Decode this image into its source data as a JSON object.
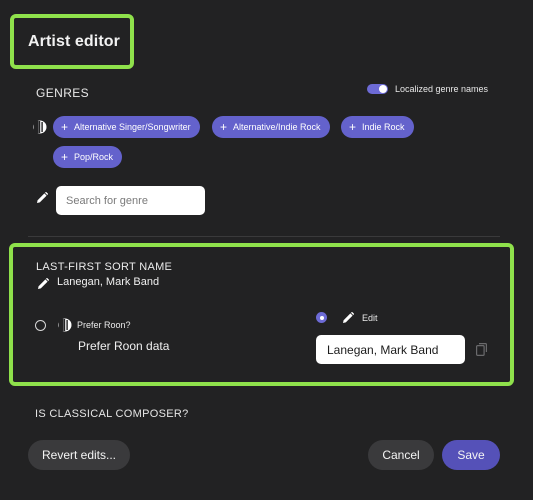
{
  "title": "Artist editor",
  "genres": {
    "heading": "GENRES",
    "toggle_label": "Localized genre names",
    "toggle_on": true,
    "chips": [
      {
        "label": "Alternative Singer/Songwriter"
      },
      {
        "label": "Alternative/Indie Rock"
      },
      {
        "label": "Indie Rock"
      },
      {
        "label": "Pop/Rock"
      }
    ],
    "search_placeholder": "Search for genre",
    "accent_color": "#6462cc"
  },
  "sort_name": {
    "heading": "LAST-FIRST SORT NAME",
    "current_value": "Lanegan, Mark Band",
    "prefer_roon_label": "Prefer Roon?",
    "prefer_roon_value": "Prefer Roon data",
    "edit_label": "Edit",
    "edit_value": "Lanegan, Mark Band",
    "selected_option": "edit"
  },
  "classical": {
    "heading": "IS CLASSICAL COMPOSER?"
  },
  "footer": {
    "revert_label": "Revert edits...",
    "cancel_label": "Cancel",
    "save_label": "Save"
  },
  "colors": {
    "highlight": "#8fe14b",
    "background": "#222223",
    "primary_button": "#5551b8"
  },
  "icons": [
    "roon-logo-icon",
    "plus-icon",
    "pencil-icon",
    "copy-icon"
  ]
}
